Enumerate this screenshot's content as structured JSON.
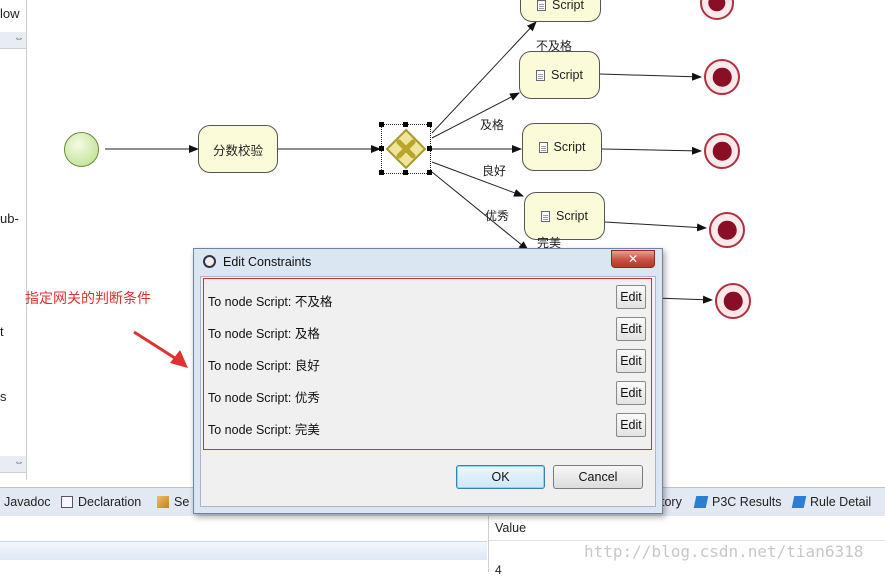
{
  "palette": {
    "fragments": [
      "low",
      "ub-",
      "t",
      "s"
    ],
    "scroll_arrows": "⇔"
  },
  "canvas": {
    "start_event": "start-event",
    "validate_task": "分数校验",
    "script_label": "Script",
    "edge_labels": [
      "不及格",
      "及格",
      "良好",
      "优秀",
      "完美"
    ]
  },
  "annotation": "指定网关的判断条件",
  "dialog": {
    "title": "Edit Constraints",
    "close": "✕",
    "constraints": [
      {
        "label": "To node Script:  不及格",
        "edit": "Edit"
      },
      {
        "label": "To node Script:  及格",
        "edit": "Edit"
      },
      {
        "label": "To node Script:  良好",
        "edit": "Edit"
      },
      {
        "label": "To node Script:  优秀",
        "edit": "Edit"
      },
      {
        "label": "To node Script:  完美",
        "edit": "Edit"
      }
    ],
    "ok": "OK",
    "cancel": "Cancel"
  },
  "bottom_tabs": {
    "javadoc": "Javadoc",
    "declaration": "Declaration",
    "partial": "Se",
    "history_partial": "tory",
    "p3c": "P3C Results",
    "rule": "Rule Detail"
  },
  "properties": {
    "value_header": "Value",
    "value_cell": "4"
  },
  "watermark": "http://blog.csdn.net/tian6318",
  "colors": {
    "annotation": "#e03030",
    "task_fill": "#fbfbd9",
    "end_event": "#8a0f24",
    "gateway": "#c8b84a"
  }
}
